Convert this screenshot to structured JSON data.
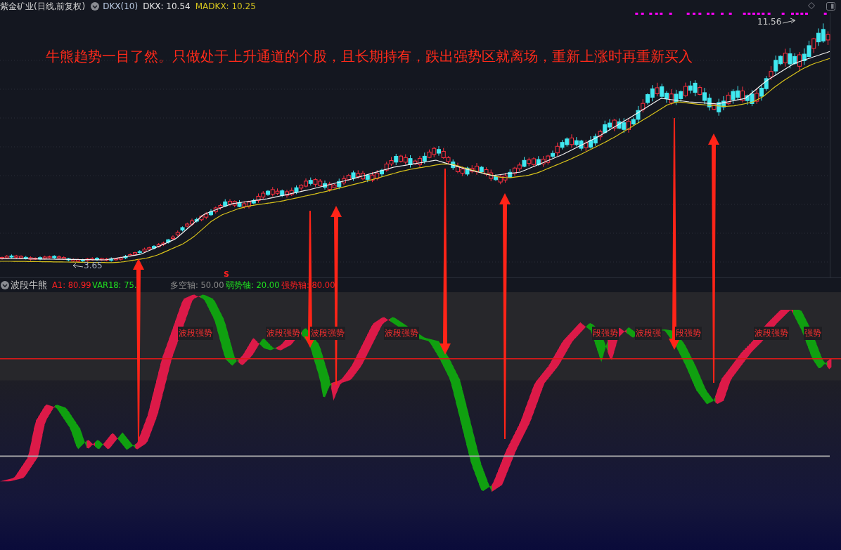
{
  "header": {
    "title": "紫金矿业(日线,前复权)",
    "indicator": "DKX(10)",
    "values": [
      {
        "text": "DKX: 10.54",
        "color": "#e6e6e6"
      },
      {
        "text": "MADKX: 10.25",
        "color": "#d4c31e"
      }
    ]
  },
  "price_chart": {
    "headline": "牛熊趋势一目了然。只做处于上升通道的个股，且长期持有，跌出强势区就离场，重新上涨时再重新买入",
    "high_label": "11.56",
    "low_label": "3.65"
  },
  "indicator": {
    "name": "波段牛熊",
    "values": [
      {
        "text": "A1: 80.99",
        "color": "#ff2020"
      },
      {
        "text": "VAR18: 75.",
        "color": "#20e020"
      },
      {
        "text": "多空轴: 50.00",
        "color": "#8a8a8a"
      },
      {
        "text": "弱势轴: 20.00",
        "color": "#20e020"
      },
      {
        "text": "强势轴: 80.00",
        "color": "#ff2020"
      }
    ],
    "marker": "S",
    "labels": [
      "波段强势",
      "波段强势",
      "波段强势",
      "波段强势",
      "段强势",
      "波段强",
      "段强势",
      "波段强势",
      "强势"
    ]
  }
}
